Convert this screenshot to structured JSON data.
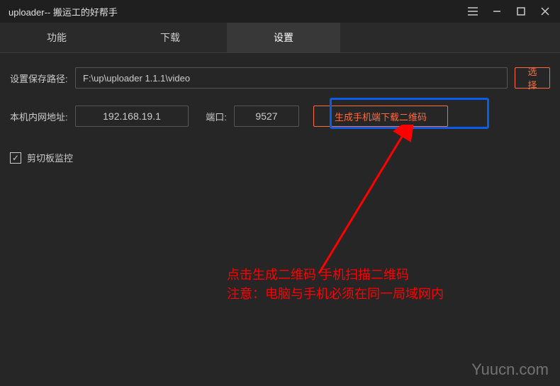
{
  "window": {
    "title": "uploader-- 搬运工的好帮手"
  },
  "tabs": [
    {
      "label": "功能"
    },
    {
      "label": "下载"
    },
    {
      "label": "设置"
    }
  ],
  "settings": {
    "path_label": "设置保存路径:",
    "path_value": "F:\\up\\uploader 1.1.1\\video",
    "select_button": "选择",
    "lan_label": "本机内网地址:",
    "lan_value": "192.168.19.1",
    "port_label": "端口:",
    "port_value": "9527",
    "qr_button": "生成手机端下载二维码",
    "clipboard_label": "剪切板监控",
    "clipboard_checked": true
  },
  "annotation": {
    "line1": "点击生成二维码 手机扫描二维码",
    "line2": "注意：电脑与手机必须在同一局域网内"
  },
  "watermark": "Yuucn.com"
}
